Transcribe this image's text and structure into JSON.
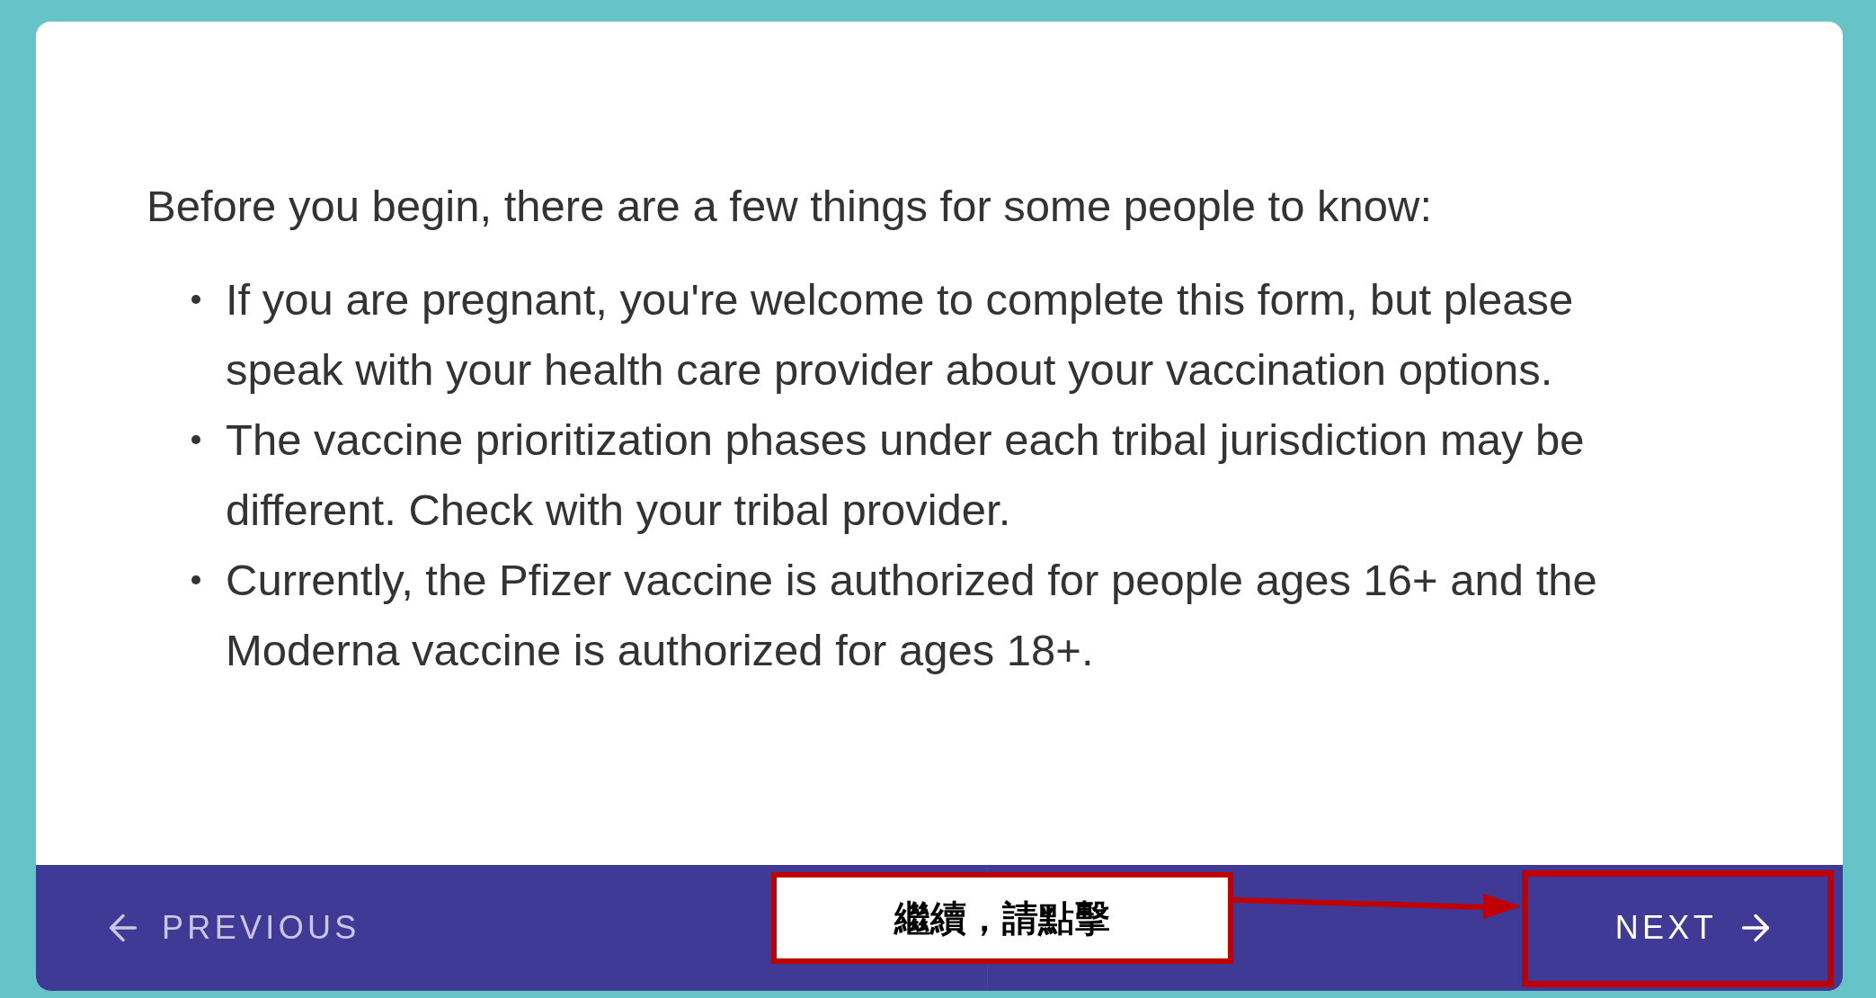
{
  "intro": "Before you begin, there are a few things for some people to know:",
  "bullets": [
    "If you are pregnant, you're welcome to complete this form, but please speak with your health care provider about your vaccination options.",
    "The vaccine prioritization phases under each tribal jurisdiction may be different. Check with your tribal provider.",
    "Currently, the Pfizer vaccine is authorized for people ages 16+ and the Moderna vaccine is authorized for ages 18+."
  ],
  "nav": {
    "previous": {
      "label": "PREVIOUS",
      "disabled": true
    },
    "next": {
      "label": "NEXT",
      "disabled": false
    }
  },
  "annotation": {
    "text": "繼續，請點擊"
  }
}
